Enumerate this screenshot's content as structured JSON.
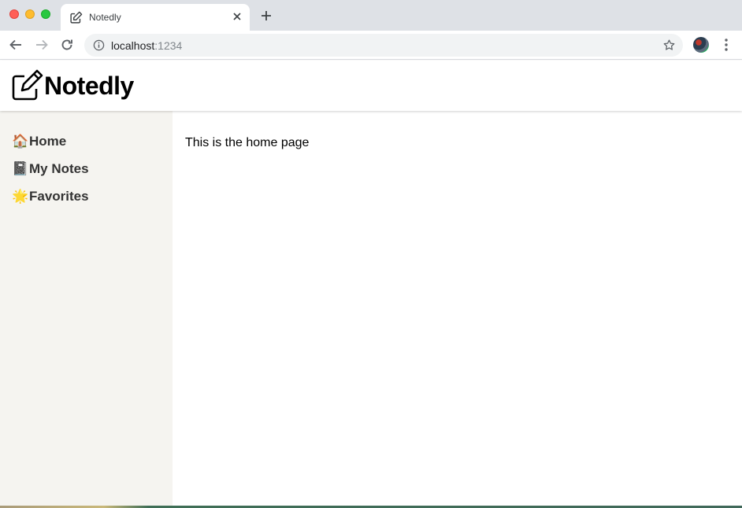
{
  "browser": {
    "tab_title": "Notedly",
    "url_host": "localhost",
    "url_port": ":1234",
    "icons": {
      "back": "arrow-left-icon",
      "forward": "arrow-right-icon",
      "reload": "reload-icon",
      "info": "info-icon",
      "bookmark": "star-icon",
      "menu": "kebab-menu-icon",
      "new_tab": "plus-icon",
      "close_tab": "close-icon"
    },
    "colors": {
      "tabstrip": "#dee1e6",
      "omnibox": "#f1f3f4",
      "close": "#ff5f57",
      "minimize": "#febc2e",
      "maximize": "#28c840"
    }
  },
  "app": {
    "brand": "Notedly",
    "logo_icon": "edit-note-icon",
    "sidebar": {
      "background": "#f5f4f0",
      "items": [
        {
          "emoji": "🏠",
          "label": "Home"
        },
        {
          "emoji": "📓",
          "label": "My Notes"
        },
        {
          "emoji": "🌟",
          "label": "Favorites"
        }
      ]
    },
    "main": {
      "text": "This is the home page"
    }
  }
}
